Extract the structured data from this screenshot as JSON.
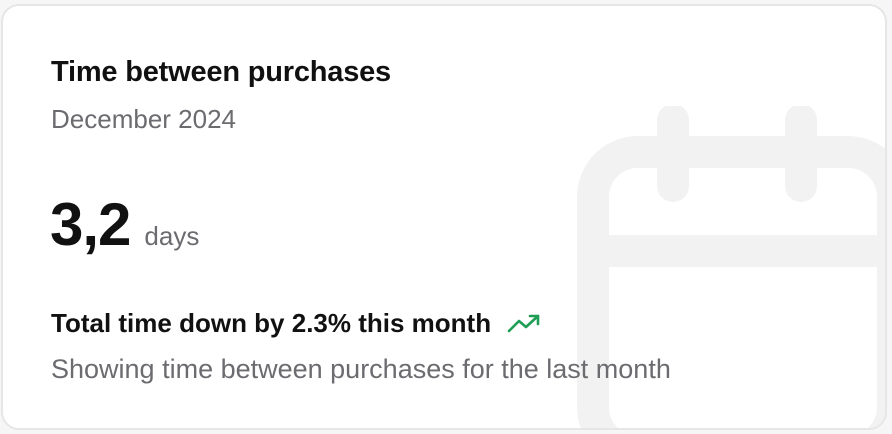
{
  "card": {
    "title": "Time between purchases",
    "period": "December 2024",
    "metric_value": "3,2",
    "metric_unit": "days",
    "trend_text": "Total time down by 2.3% this month",
    "trend_icon": "trending-up-icon",
    "description": "Showing time between purchases for the last month",
    "background_icon": "calendar-icon"
  },
  "colors": {
    "trend": "#1f9d55",
    "title": "#111111",
    "muted": "#6b6b70",
    "watermark": "#f2f2f3"
  }
}
